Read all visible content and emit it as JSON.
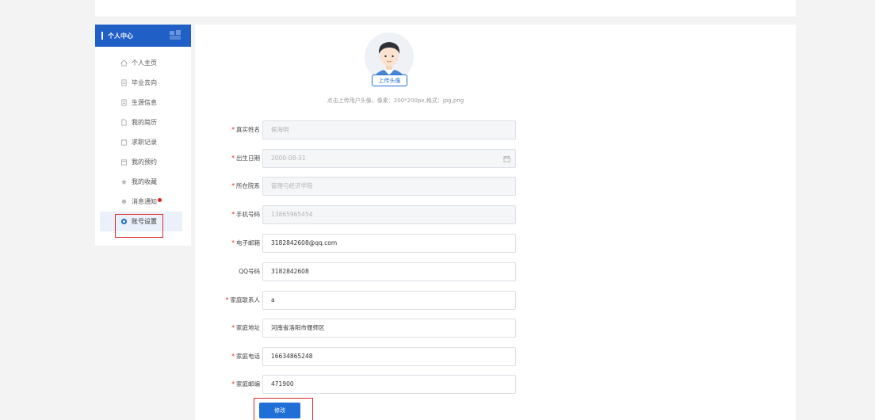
{
  "sidebar": {
    "title": "个人中心",
    "items": [
      {
        "label": "个人主页",
        "icon": "home-icon"
      },
      {
        "label": "毕业去向",
        "icon": "document-icon"
      },
      {
        "label": "生源信息",
        "icon": "document-icon"
      },
      {
        "label": "我的简历",
        "icon": "file-icon"
      },
      {
        "label": "求职记录",
        "icon": "record-icon"
      },
      {
        "label": "我的预约",
        "icon": "calendar-icon"
      },
      {
        "label": "我的收藏",
        "icon": "star-icon"
      },
      {
        "label": "消息通知",
        "icon": "bell-icon"
      },
      {
        "label": "账号设置",
        "icon": "settings-icon"
      }
    ]
  },
  "profile": {
    "upload_label": "上传头像",
    "upload_hint": "点击上传用户头像，像素：200*200px,格式：jpg,png"
  },
  "form": {
    "name": {
      "label": "真实姓名",
      "value": "侯海明",
      "required": true
    },
    "birth": {
      "label": "出生日期",
      "value": "2000-08-31",
      "required": true
    },
    "dept": {
      "label": "所在院系",
      "value": "管理与经济学院",
      "required": true
    },
    "phone": {
      "label": "手机号码",
      "value": "13865965454",
      "required": true
    },
    "email": {
      "label": "电子邮箱",
      "value": "3182842608@qq.com",
      "required": true
    },
    "qq": {
      "label": "QQ号码",
      "value": "3182842608",
      "required": false
    },
    "contact": {
      "label": "家庭联系人",
      "value": "a",
      "required": true
    },
    "address": {
      "label": "家庭地址",
      "value": "河南省洛阳市偃师区",
      "required": true
    },
    "home_phone": {
      "label": "家庭电话",
      "value": "16634865248",
      "required": true
    },
    "zip": {
      "label": "家庭邮编",
      "value": "471900",
      "required": true
    },
    "required_mark": "*"
  },
  "actions": {
    "submit_label": "修改"
  },
  "colors": {
    "primary": "#1f6fd6",
    "highlight": "#e0282a",
    "required": "#e02020"
  }
}
